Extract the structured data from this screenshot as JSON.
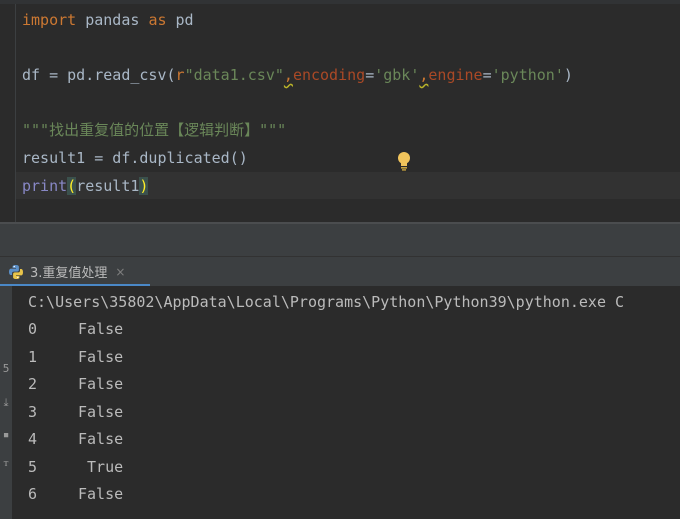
{
  "editor": {
    "line1": {
      "kw_import": "import",
      "mod": " pandas ",
      "kw_as": "as",
      "alias": " pd"
    },
    "line2": {
      "pre": "df = pd.read_csv(",
      "rprefix": "r",
      "path": "\"data1.csv\"",
      "comma1": ",",
      "p1": "encoding",
      "eq1": "=",
      "v1": "'gbk'",
      "comma2": ",",
      "p2": "engine",
      "eq2": "=",
      "v2": "'python'",
      "close": ")"
    },
    "line3": "\"\"\"找出重复值的位置【逻辑判断】\"\"\"",
    "line4": "result1 = df.duplicated()",
    "line5": {
      "fn": "print",
      "open": "(",
      "arg": "result1",
      "close": ")"
    }
  },
  "tool_window": {
    "tab_label": "3.重复值处理",
    "close_glyph": "×",
    "tab_icon": "python-icon"
  },
  "console": {
    "command": "C:\\Users\\35802\\AppData\\Local\\Programs\\Python\\Python39\\python.exe C",
    "rows": [
      {
        "index": "0",
        "value": "False"
      },
      {
        "index": "1",
        "value": "False"
      },
      {
        "index": "2",
        "value": "False"
      },
      {
        "index": "3",
        "value": "False"
      },
      {
        "index": "4",
        "value": "False"
      },
      {
        "index": "5",
        "value": " True"
      },
      {
        "index": "6",
        "value": "False"
      }
    ],
    "left_strip_glyphs": [
      "5",
      "⤓",
      "▪",
      "ᴛ"
    ]
  },
  "colors": {
    "keyword": "#cc7832",
    "string": "#6a8759",
    "param": "#aa4926",
    "builtin": "#8888c6",
    "text": "#a9b7c6",
    "tab_accent": "#4a88c7",
    "bulb": "#f2c55c"
  }
}
